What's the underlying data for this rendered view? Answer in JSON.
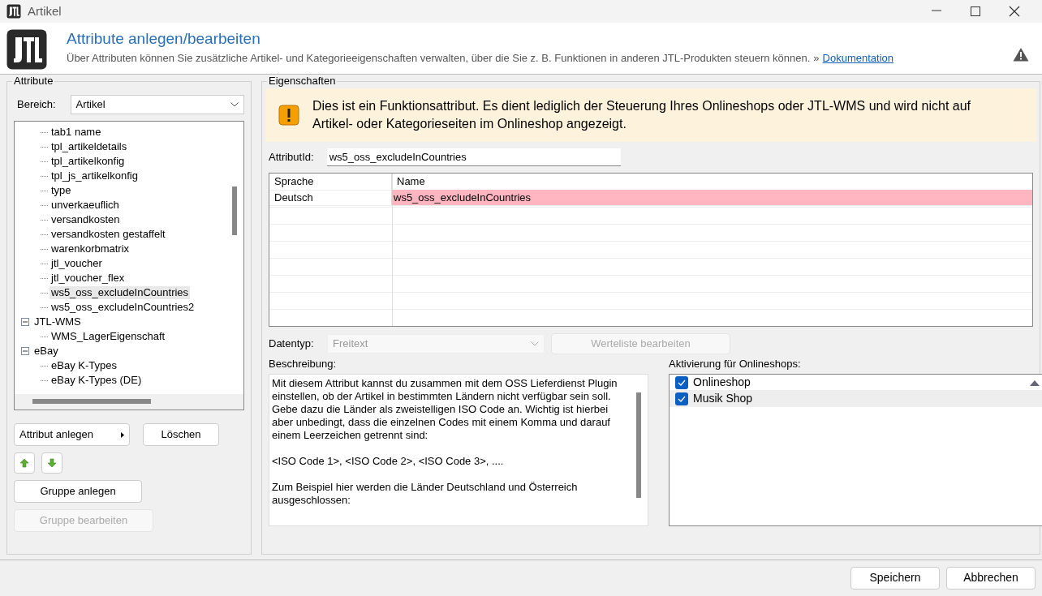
{
  "window": {
    "title": "Artikel"
  },
  "header": {
    "title": "Attribute anlegen/bearbeiten",
    "description": "Über Attributen können Sie zusätzliche Artikel- und Kategorieeigenschaften verwalten, über die Sie z. B. Funktionen in anderen JTL-Produkten steuern können.",
    "link_prefix": "»",
    "link": "Dokumentation"
  },
  "left": {
    "legend": "Attribute",
    "bereich_label": "Bereich:",
    "bereich_value": "Artikel",
    "tree": [
      {
        "children": [
          {
            "label": "tab1 name",
            "selected": false
          },
          {
            "label": "tpl_artikeldetails",
            "selected": false
          },
          {
            "label": "tpl_artikelkonfig",
            "selected": false
          },
          {
            "label": "tpl_js_artikelkonfig",
            "selected": false
          },
          {
            "label": "type",
            "selected": false
          },
          {
            "label": "unverkaeuflich",
            "selected": false
          },
          {
            "label": "versandkosten",
            "selected": false
          },
          {
            "label": "versandkosten gestaffelt",
            "selected": false
          },
          {
            "label": "warenkorbmatrix",
            "selected": false
          },
          {
            "label": "jtl_voucher",
            "selected": false
          },
          {
            "label": "jtl_voucher_flex",
            "selected": false
          },
          {
            "label": "ws5_oss_excludeInCountries",
            "selected": true
          },
          {
            "label": "ws5_oss_excludeInCountries2",
            "selected": false
          }
        ]
      },
      {
        "label": "JTL-WMS",
        "expanded": true,
        "selected": false,
        "children": [
          {
            "label": "WMS_LagerEigenschaft",
            "selected": false
          }
        ]
      },
      {
        "label": "eBay",
        "expanded": true,
        "selected": false,
        "children": [
          {
            "label": "eBay K-Types",
            "selected": false
          },
          {
            "label": "eBay K-Types (DE)",
            "selected": false
          }
        ]
      }
    ],
    "buttons": [
      {
        "label": "Attribut anlegen",
        "kind": "menu",
        "disabled": false
      },
      {
        "label": "Löschen",
        "kind": "plain",
        "disabled": false
      }
    ],
    "group_buttons": [
      {
        "label": "Gruppe anlegen",
        "disabled": false
      },
      {
        "label": "Gruppe bearbeiten",
        "disabled": true
      }
    ]
  },
  "right": {
    "legend": "Eigenschaften",
    "notice": "Dies ist ein Funktionsattribut. Es dient lediglich der Steuerung Ihres Onlineshops oder JTL-WMS und wird nicht auf Artikel- oder Kategorieseiten im Onlineshop angezeigt.",
    "attribut_id_label": "AttributId:",
    "attribut_id": "ws5_oss_excludeInCountries",
    "table": {
      "columns": [
        "Sprache",
        "Name"
      ],
      "rows": [
        {
          "cells": [
            "Deutsch",
            "ws5_oss_excludeInCountries"
          ],
          "invalid": true
        }
      ]
    },
    "datentyp_label": "Datentyp:",
    "datentyp": {
      "value": "Freitext",
      "disabled": true
    },
    "werteliste_button": {
      "label": "Werteliste bearbeiten",
      "disabled": true
    },
    "beschreibung_label": "Beschreibung:",
    "beschreibung": "Mit diesem Attribut kannst du zusammen mit dem OSS Lieferdienst Plugin einstellen, ob der Artikel in bestimmten Ländern nicht verfügbar sein soll. Gebe dazu die Länder als zweistelligen ISO Code an. Wichtig ist hierbei aber unbedingt, dass die einzelnen Codes mit einem Komma und darauf einem Leerzeichen getrennt sind:\n\n<ISO Code 1>, <ISO Code 2>, <ISO Code 3>, ....\n\nZum Beispiel hier werden die Länder Deutschland und Österreich ausgeschlossen:",
    "shops_label": "Aktivierung für Onlineshops:",
    "shops": [
      {
        "label": "Onlineshop",
        "checked": true,
        "selected": false
      },
      {
        "label": "Musik Shop",
        "checked": true,
        "selected": true
      }
    ]
  },
  "footer": {
    "buttons": [
      {
        "label": "Speichern"
      },
      {
        "label": "Abbrechen"
      }
    ]
  }
}
